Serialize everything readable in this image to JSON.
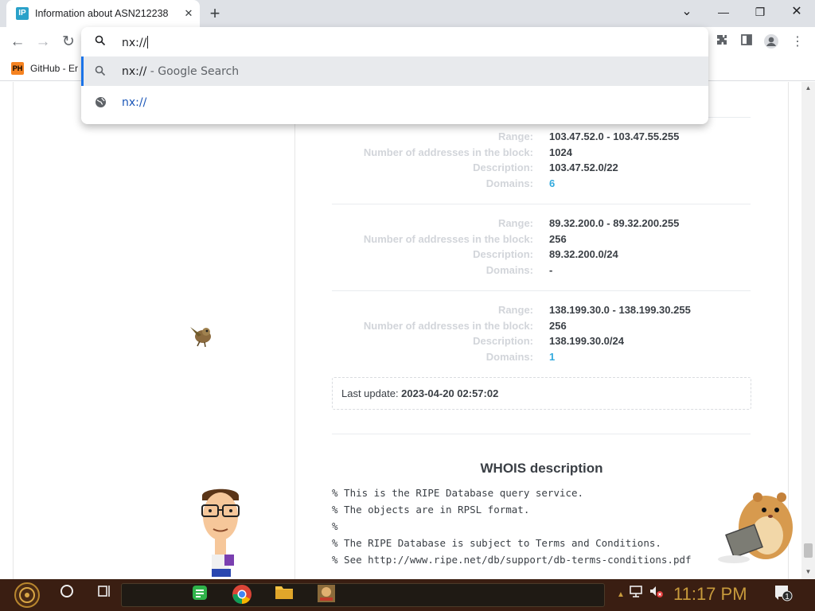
{
  "window": {
    "tab_title": "Information about ASN212238",
    "tab_favicon": "IP",
    "tab_close_glyph": "✕",
    "new_tab_glyph": "+",
    "minimize_glyph": "—",
    "restore_glyph": "❐",
    "close_glyph": "✕",
    "tabsearch_glyph": "⌄"
  },
  "toolbar": {
    "back_glyph": "←",
    "forward_glyph": "→",
    "reload_glyph": "↻"
  },
  "bookmarks": {
    "items": [
      {
        "label": "GitHub - Er",
        "icon": "PH"
      }
    ]
  },
  "omnibox": {
    "input_value": "nx://",
    "suggestions": [
      {
        "query": "nx://",
        "hint": " - Google Search",
        "icon": "search-icon"
      },
      {
        "query": "nx://",
        "hint": "",
        "icon": "globe-icon"
      }
    ]
  },
  "ranges": [
    {
      "range": "103.47.52.0 - 103.47.55.255",
      "count": "1024",
      "description": "103.47.52.0/22",
      "domains": "6"
    },
    {
      "range": "89.32.200.0 - 89.32.200.255",
      "count": "256",
      "description": "89.32.200.0/24",
      "domains": "-"
    },
    {
      "range": "138.199.30.0 - 138.199.30.255",
      "count": "256",
      "description": "138.199.30.0/24",
      "domains": "1"
    }
  ],
  "labels": {
    "range": "Range:",
    "count": "Number of addresses in the block:",
    "description": "Description:",
    "domains": "Domains:"
  },
  "last_update": {
    "label": "Last update: ",
    "value": "2023-04-20 02:57:02"
  },
  "whois": {
    "title": "WHOIS description",
    "lines": [
      "% This is the RIPE Database query service.",
      "% The objects are in RPSL format.",
      "%",
      "% The RIPE Database is subject to Terms and Conditions.",
      "% See http://www.ripe.net/db/support/db-terms-conditions.pdf"
    ]
  },
  "taskbar": {
    "clock": "11:17 PM",
    "notification_badge": "1"
  },
  "colors": {
    "label_gray": "#d2d5da",
    "value_dark": "#3a3f45",
    "link_blue": "#33aadd",
    "omnibox_accent": "#1a73e8"
  }
}
